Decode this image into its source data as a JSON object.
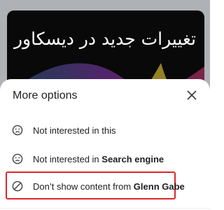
{
  "video": {
    "title": "تغییرات جدید در دیسکاور",
    "background_color": "#090909"
  },
  "sheet": {
    "title": "More options",
    "close_icon": "close-icon",
    "options": [
      {
        "icon": "sad-face-icon",
        "text": "Not interested in this",
        "bold": ""
      },
      {
        "icon": "sad-face-icon",
        "text": "Not interested in ",
        "bold": "Search engine"
      },
      {
        "icon": "block-icon",
        "text": "Don’t show content from ",
        "bold": "Glenn Gabe"
      }
    ]
  },
  "colors": {
    "highlight": "#e0262b",
    "text": "#202124",
    "icon": "#3c4043"
  }
}
